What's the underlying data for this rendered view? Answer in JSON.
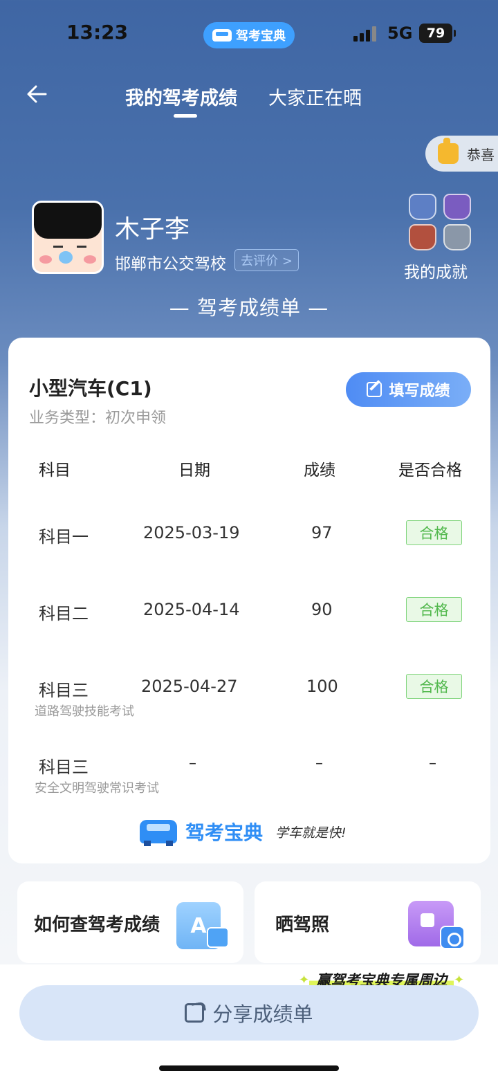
{
  "status_bar": {
    "time": "13:23",
    "app_pill_label": "驾考宝典",
    "network": "5G",
    "battery": "79"
  },
  "nav": {
    "tab_active": "我的驾考成绩",
    "tab_other": "大家正在晒"
  },
  "congrats_text": "恭喜",
  "profile": {
    "name": "木子李",
    "school": "邯郸市公交驾校",
    "rate_label": "去评价 >",
    "achievements_label": "我的成就"
  },
  "report_title": "— 驾考成绩单 —",
  "card": {
    "vehicle_type": "小型汽车(C1)",
    "business_type": "业务类型：初次申领",
    "fill_button": "填写成绩",
    "headers": {
      "subject": "科目",
      "date": "日期",
      "score": "成绩",
      "passed": "是否合格"
    },
    "rows": [
      {
        "subject": "科目一",
        "sub": "",
        "date": "2025-03-19",
        "score": "97",
        "passed": "合格"
      },
      {
        "subject": "科目二",
        "sub": "",
        "date": "2025-04-14",
        "score": "90",
        "passed": "合格"
      },
      {
        "subject": "科目三",
        "sub": "道路驾驶技能考试",
        "date": "2025-04-27",
        "score": "100",
        "passed": "合格"
      },
      {
        "subject": "科目三",
        "sub": "安全文明驾驶常识考试",
        "date": "–",
        "score": "–",
        "passed": "–"
      }
    ],
    "brand_name": "驾考宝典",
    "brand_slogan": "学车就是快!"
  },
  "tiles": {
    "query": "如何查驾考成绩",
    "query_icon_letter": "A",
    "show_license": "晒驾照"
  },
  "promo": "赢驾考宝典专属周边",
  "share_button": "分享成绩单",
  "colors": {
    "header_bg": "#3f66a4",
    "accent_blue": "#4f8cf4",
    "pass_green": "#52b84d",
    "share_bg": "#d8e5f8"
  }
}
